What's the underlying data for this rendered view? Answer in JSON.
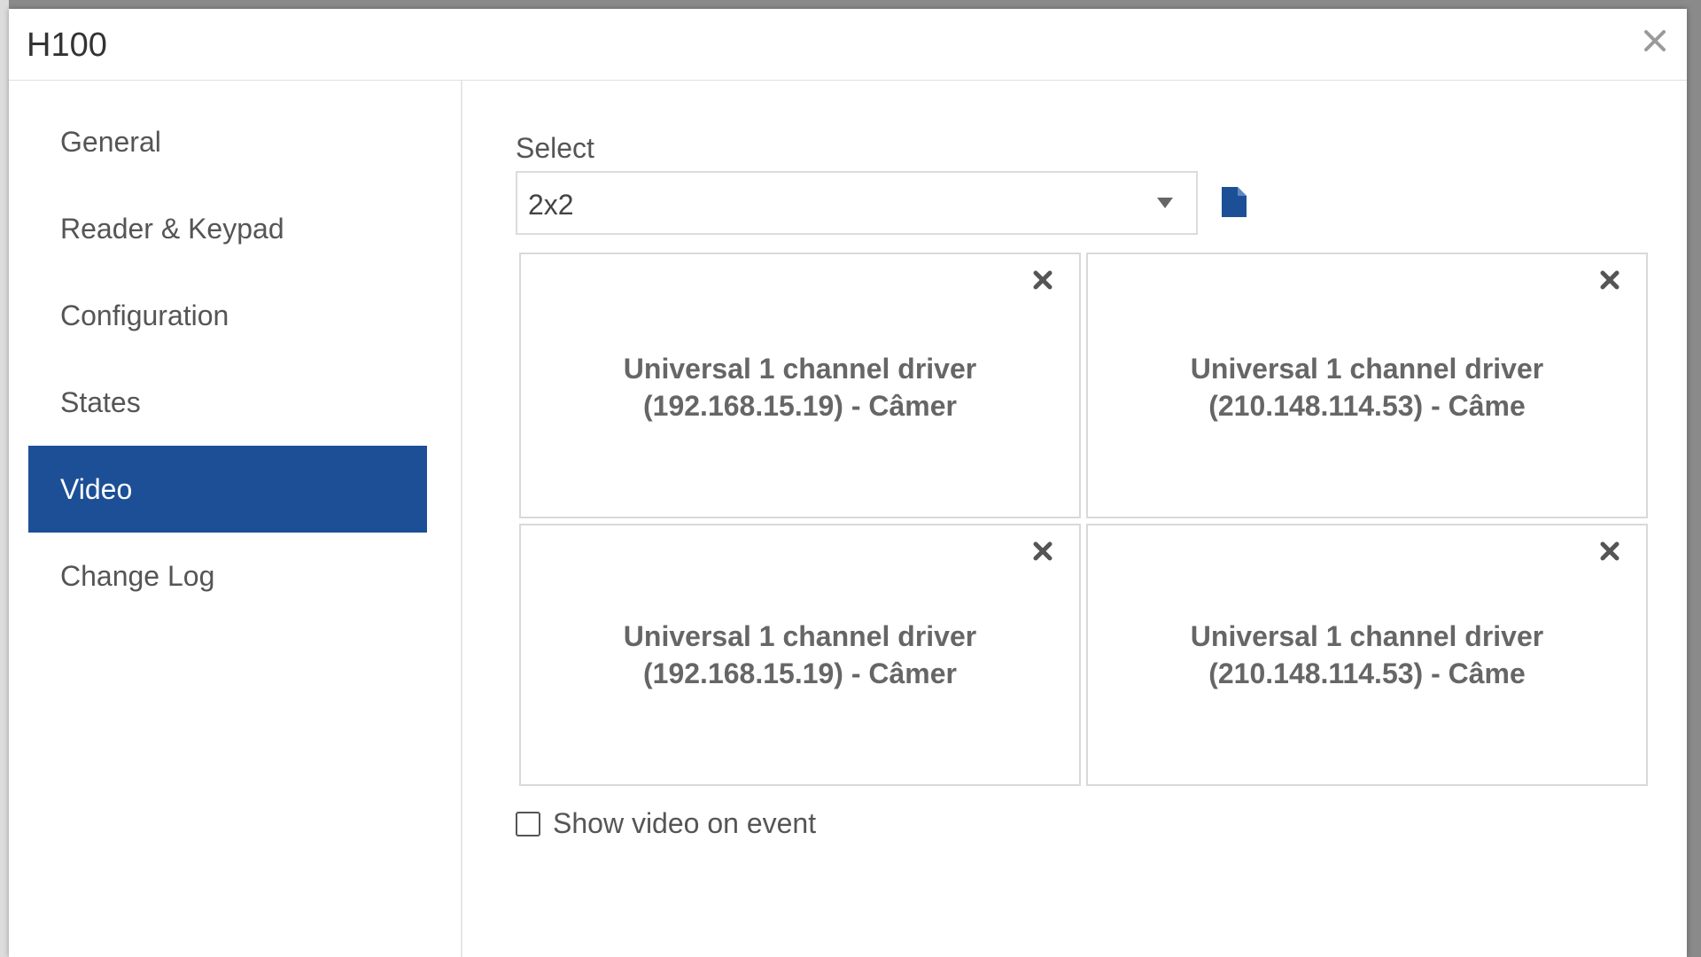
{
  "modal": {
    "title": "H100"
  },
  "sidebar": {
    "items": [
      {
        "label": "General",
        "active": false
      },
      {
        "label": "Reader & Keypad",
        "active": false
      },
      {
        "label": "Configuration",
        "active": false
      },
      {
        "label": "States",
        "active": false
      },
      {
        "label": "Video",
        "active": true
      },
      {
        "label": "Change Log",
        "active": false
      }
    ]
  },
  "video": {
    "select_label": "Select",
    "layout_value": "2x2",
    "cells": [
      {
        "line1": "Universal 1 channel driver",
        "line2": "(192.168.15.19) - Câmer"
      },
      {
        "line1": "Universal 1 channel driver",
        "line2": "(210.148.114.53) - Câme"
      },
      {
        "line1": "Universal 1 channel driver",
        "line2": "(192.168.15.19) - Câmer"
      },
      {
        "line1": "Universal 1 channel driver",
        "line2": "(210.148.114.53) - Câme"
      }
    ],
    "show_on_event_label": "Show video on event",
    "show_on_event_checked": false
  },
  "colors": {
    "accent": "#1c4f96",
    "text": "#555555",
    "border": "#d9d9d9"
  },
  "icons": {
    "close": "close-icon",
    "document": "document-icon",
    "remove": "remove-icon",
    "dropdown": "chevron-down-icon"
  }
}
